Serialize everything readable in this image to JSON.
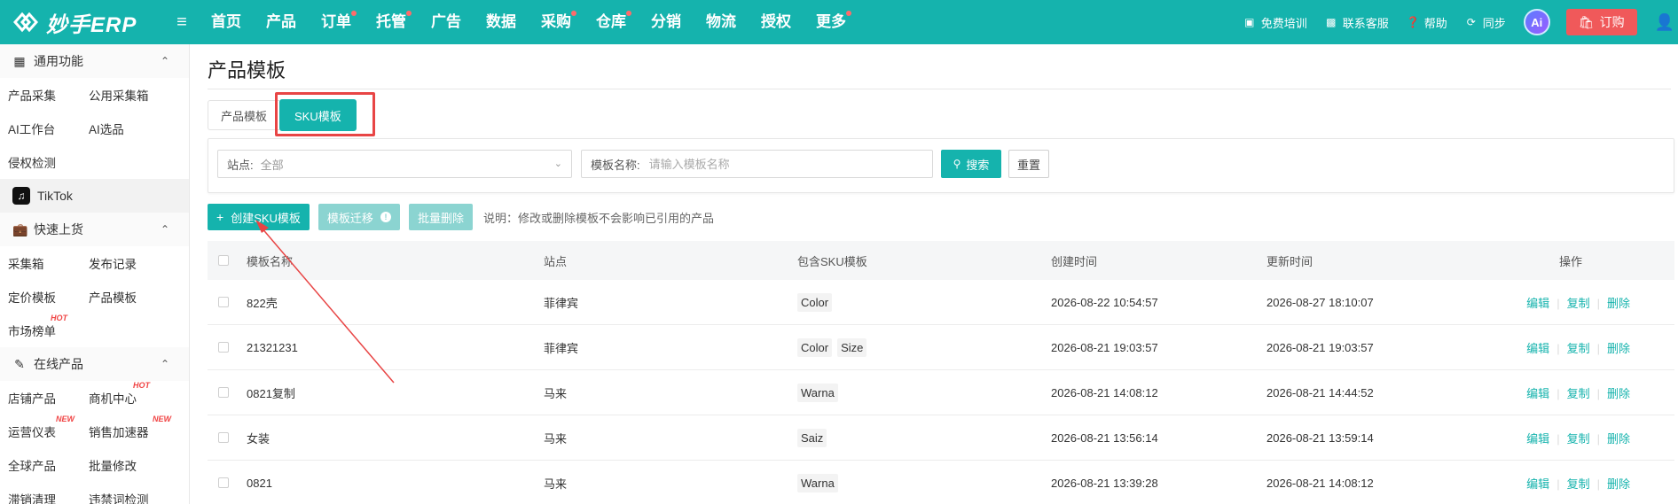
{
  "app": {
    "name": "妙手ERP"
  },
  "nav": {
    "items": [
      {
        "label": "首页",
        "dot": false
      },
      {
        "label": "产品",
        "dot": false
      },
      {
        "label": "订单",
        "dot": true
      },
      {
        "label": "托管",
        "dot": true
      },
      {
        "label": "广告",
        "dot": false
      },
      {
        "label": "数据",
        "dot": false
      },
      {
        "label": "采购",
        "dot": true
      },
      {
        "label": "仓库",
        "dot": true
      },
      {
        "label": "分销",
        "dot": false
      },
      {
        "label": "物流",
        "dot": false
      },
      {
        "label": "授权",
        "dot": false
      },
      {
        "label": "更多",
        "dot": true
      }
    ]
  },
  "tools": {
    "training": "免费培训",
    "support": "联系客服",
    "help": "帮助",
    "sync": "同步",
    "ai": "Ai",
    "order": "订购"
  },
  "sidebar": {
    "group1": {
      "title": "通用功能"
    },
    "g1_items": [
      "产品采集",
      "公用采集箱",
      "AI工作台",
      "AI选品",
      "侵权检测"
    ],
    "tiktok": "TikTok",
    "group2": {
      "title": "快速上货"
    },
    "g2_items": [
      "采集箱",
      "发布记录",
      "定价模板",
      "产品模板",
      "市场榜单"
    ],
    "group3": {
      "title": "在线产品"
    },
    "g3_items": [
      "店铺产品",
      "商机中心",
      "运营仪表",
      "销售加速器",
      "全球产品",
      "批量修改",
      "滞销清理",
      "违禁词检测"
    ],
    "tags": {
      "hot": "HOT",
      "new": "NEW"
    }
  },
  "page": {
    "title": "产品模板",
    "tabs": [
      "产品模板",
      "SKU模板"
    ]
  },
  "filter": {
    "site_label": "站点:",
    "site_value": "全部",
    "name_label": "模板名称:",
    "name_placeholder": "请输入模板名称",
    "search": "搜索",
    "reset": "重置"
  },
  "actions": {
    "create": "创建SKU模板",
    "migrate": "模板迁移",
    "batch_delete": "批量删除",
    "note": "说明：修改或删除模板不会影响已引用的产品"
  },
  "table": {
    "headers": {
      "name": "模板名称",
      "site": "站点",
      "sku": "包含SKU模板",
      "created": "创建时间",
      "updated": "更新时间",
      "ops": "操作"
    },
    "ops": {
      "edit": "编辑",
      "copy": "复制",
      "delete": "删除"
    },
    "rows": [
      {
        "name": "822壳",
        "site": "菲律宾",
        "sku": [
          "Color"
        ],
        "created": "2026-08-22 10:54:57",
        "updated": "2026-08-27 18:10:07"
      },
      {
        "name": "21321231",
        "site": "菲律宾",
        "sku": [
          "Color",
          "Size"
        ],
        "created": "2026-08-21 19:03:57",
        "updated": "2026-08-21 19:03:57"
      },
      {
        "name": "0821复制",
        "site": "马来",
        "sku": [
          "Warna"
        ],
        "created": "2026-08-21 14:08:12",
        "updated": "2026-08-21 14:44:52"
      },
      {
        "name": "女装",
        "site": "马来",
        "sku": [
          "Saiz"
        ],
        "created": "2026-08-21 13:56:14",
        "updated": "2026-08-21 13:59:14"
      },
      {
        "name": "0821",
        "site": "马来",
        "sku": [
          "Warna"
        ],
        "created": "2026-08-21 13:39:28",
        "updated": "2026-08-21 14:08:12"
      }
    ]
  },
  "colors": {
    "brand": "#15b3ad",
    "order_button": "#f0595a",
    "annotation": "#e84545"
  },
  "icons": {
    "logo": "logo-icon",
    "menu": "menu-toggle-icon",
    "training": "training-icon",
    "support": "chat-icon",
    "help": "help-icon",
    "sync": "sync-icon",
    "order": "bag-icon",
    "user": "user-icon",
    "search": "search-icon"
  }
}
